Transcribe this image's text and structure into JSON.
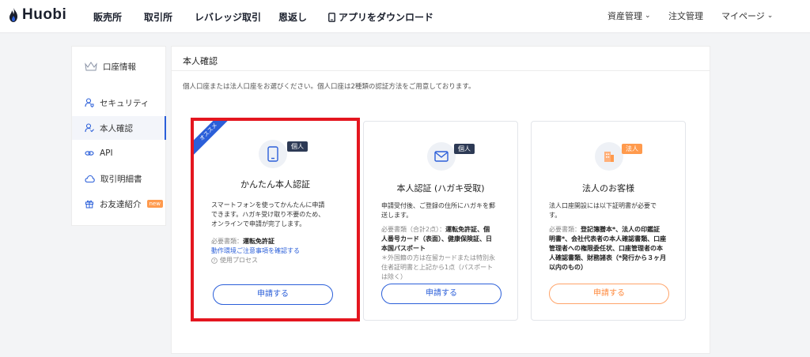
{
  "brand": {
    "name": "Huobi",
    "color": "#2b5fd9"
  },
  "nav": {
    "items": [
      "販売所",
      "取引所",
      "レバレッジ取引",
      "恩返し",
      "アプリをダウンロード"
    ],
    "right": [
      "資産管理",
      "注文管理",
      "マイページ"
    ]
  },
  "sidebar": {
    "items": [
      {
        "label": "口座情報",
        "icon": "crown-icon"
      },
      {
        "label": "セキュリティ",
        "icon": "user-shield-icon"
      },
      {
        "label": "本人確認",
        "icon": "user-check-icon",
        "active": true
      },
      {
        "label": "API",
        "icon": "link-icon"
      },
      {
        "label": "取引明細書",
        "icon": "cloud-icon"
      },
      {
        "label": "お友達紹介",
        "icon": "gift-icon",
        "badge": "new"
      }
    ]
  },
  "main": {
    "title": "本人確認",
    "description": "個人口座または法人口座をお選びください。個人口座は2種類の認証方法をご用意しております。"
  },
  "cards": [
    {
      "ribbon": "オススメ",
      "badge": "個人",
      "title": "かんたん本人認証",
      "desc": [
        "スマートフォンを使ってかんたんに申請",
        "できます。ハガキ受け取り不要のため、",
        "オンラインで申請が完了します。"
      ],
      "docs_label": "必要書類：",
      "docs_value": "運転免許証",
      "link": "動作環境ご注意事項を確認する",
      "process": "使用プロセス",
      "button": "申請する"
    },
    {
      "badge": "個人",
      "title": "本人認証 (ハガキ受取)",
      "desc": [
        "申請受付後、ご登録の住所にハガキを郵",
        "送します。"
      ],
      "docs_label": "必要書類（合計2点）：",
      "docs_value_lines": [
        "運転免許証、個",
        "人番号カード（表面）、健康保険証、日",
        "本国パスポート"
      ],
      "note": [
        "＊外国籍の方は在留カードまたは特別永",
        "住者証明書と上記から1点（パスポート",
        "は除く）"
      ],
      "button": "申請する"
    },
    {
      "badge": "法人",
      "title": "法人のお客様",
      "desc": [
        "法人口座開設には以下証明書が必要で",
        "す。"
      ],
      "docs_label": "必要書類：",
      "docs_value_lines": [
        "登記簿謄本*、法人の印鑑証",
        "明書*、会社代表者の本人確認書類、口座",
        "管理者への権限委任状、口座管理者の本",
        "人確認書類、財務諸表（*発行から３ヶ月",
        "以内のもの）"
      ],
      "button": "申請する"
    }
  ]
}
